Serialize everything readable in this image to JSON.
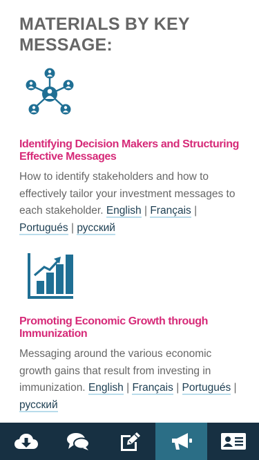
{
  "section": {
    "title": "MATERIALS BY KEY MESSAGE:"
  },
  "items": [
    {
      "icon": "network-people-icon",
      "title": "Identifying Decision Makers and Structuring Effective Messages",
      "description": "How to identify stakeholders and how to effectively tailor your investment messages to each stakeholder.",
      "links": [
        "English",
        "Français",
        "Portugués",
        "русский"
      ]
    },
    {
      "icon": "bar-chart-growth-icon",
      "title": "Promoting Economic Growth through Immunization",
      "description": "Messaging around the various economic growth gains that result from investing in immunization.",
      "links": [
        "English",
        "Français",
        "Portugués",
        "русский"
      ]
    }
  ],
  "separator": "|",
  "tabbar": {
    "tabs": [
      {
        "icon": "cloud-download-icon",
        "active": false
      },
      {
        "icon": "chat-bubbles-icon",
        "active": false
      },
      {
        "icon": "edit-icon",
        "active": false
      },
      {
        "icon": "megaphone-icon",
        "active": true
      },
      {
        "icon": "contact-card-icon",
        "active": false
      }
    ],
    "colors": {
      "background": "#173042",
      "active": "#2b6e86",
      "icon": "#ffffff"
    }
  },
  "colors": {
    "heading": "#666666",
    "item_title": "#d62a78",
    "link": "#1c3e52",
    "link_underline": "#b9dceb",
    "icon_blue": "#1f6f94"
  }
}
